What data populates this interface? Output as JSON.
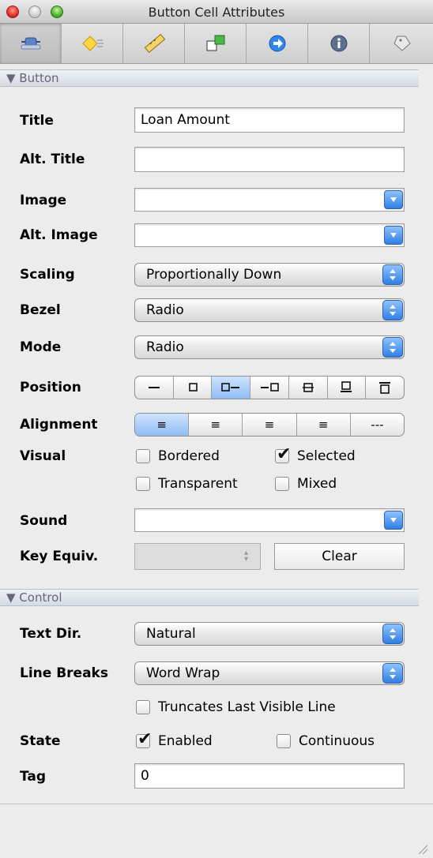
{
  "window": {
    "title": "Button Cell Attributes"
  },
  "toolbar": {
    "tabs": [
      {
        "icon": "attributes-icon",
        "active": true
      },
      {
        "icon": "effects-icon",
        "active": false
      },
      {
        "icon": "size-ruler-icon",
        "active": false
      },
      {
        "icon": "connections-icon",
        "active": false
      },
      {
        "icon": "bindings-icon",
        "active": false
      },
      {
        "icon": "info-icon",
        "active": false
      },
      {
        "icon": "identity-icon",
        "active": false
      }
    ]
  },
  "sections": {
    "button": {
      "header": "▼ Button",
      "title_label": "Title",
      "title_value": "Loan Amount",
      "alt_title_label": "Alt. Title",
      "alt_title_value": "",
      "image_label": "Image",
      "image_value": "",
      "alt_image_label": "Alt. Image",
      "alt_image_value": "",
      "scaling_label": "Scaling",
      "scaling_value": "Proportionally Down",
      "bezel_label": "Bezel",
      "bezel_value": "Radio",
      "mode_label": "Mode",
      "mode_value": "Radio",
      "position_label": "Position",
      "alignment_label": "Alignment",
      "visual_label": "Visual",
      "visual_options": {
        "bordered": {
          "label": "Bordered",
          "checked": false
        },
        "selected": {
          "label": "Selected",
          "checked": true
        },
        "transparent": {
          "label": "Transparent",
          "checked": false
        },
        "mixed": {
          "label": "Mixed",
          "checked": false
        }
      },
      "sound_label": "Sound",
      "sound_value": "",
      "key_equiv_label": "Key Equiv.",
      "clear_label": "Clear"
    },
    "control": {
      "header": "▼ Control",
      "text_dir_label": "Text Dir.",
      "text_dir_value": "Natural",
      "line_breaks_label": "Line Breaks",
      "line_breaks_value": "Word Wrap",
      "truncates_label": "Truncates Last Visible Line",
      "truncates_checked": false,
      "state_label": "State",
      "enabled_label": "Enabled",
      "enabled_checked": true,
      "continuous_label": "Continuous",
      "continuous_checked": false,
      "tag_label": "Tag",
      "tag_value": "0"
    }
  },
  "alignment_glyphs": [
    "≡",
    "≡",
    "≡",
    "≡",
    "---"
  ]
}
